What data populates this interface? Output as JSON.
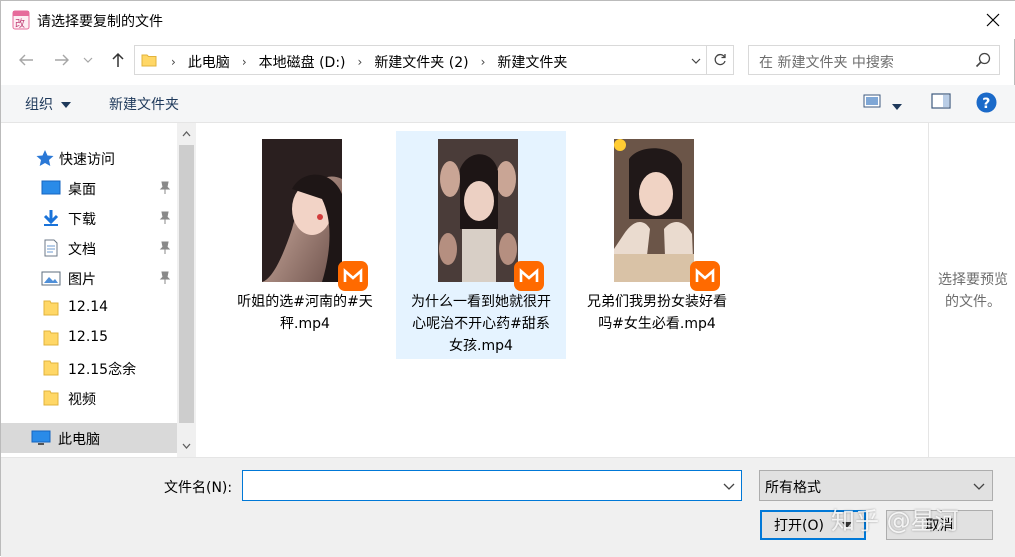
{
  "window": {
    "title": "请选择要复制的文件"
  },
  "address": {
    "crumbs": [
      "此电脑",
      "本地磁盘 (D:)",
      "新建文件夹 (2)",
      "新建文件夹"
    ]
  },
  "search": {
    "placeholder": "在 新建文件夹 中搜索"
  },
  "toolbar": {
    "organize_label": "组织",
    "new_folder_label": "新建文件夹"
  },
  "sidebar": {
    "items": [
      {
        "label": "快速访问",
        "icon": "star-icon"
      },
      {
        "label": "桌面",
        "icon": "desktop-icon",
        "pinned": true
      },
      {
        "label": "下载",
        "icon": "download-icon",
        "pinned": true
      },
      {
        "label": "文档",
        "icon": "document-icon",
        "pinned": true
      },
      {
        "label": "图片",
        "icon": "pictures-icon",
        "pinned": true
      },
      {
        "label": "12.14",
        "icon": "folder-icon"
      },
      {
        "label": "12.15",
        "icon": "folder-icon"
      },
      {
        "label": "12.15念余",
        "icon": "folder-icon"
      },
      {
        "label": "视频",
        "icon": "folder-icon"
      },
      {
        "label": "此电脑",
        "icon": "computer-icon",
        "selected": true
      }
    ]
  },
  "files": [
    {
      "name": "听姐的选#河南的#天秤.mp4",
      "line1": "听姐的选#河南的#天",
      "line2": "秤.mp4",
      "line3": "",
      "selected": false
    },
    {
      "name": "为什么一看到她就很开心呢治不开心药#甜系女孩.mp4",
      "line1": "为什么一看到她就很开",
      "line2": "心呢治不开心药#甜系",
      "line3": "女孩.mp4",
      "selected": true
    },
    {
      "name": "兄弟们我男扮女装好看吗#女生必看.mp4",
      "line1": "兄弟们我男扮女装好看",
      "line2": "吗#女生必看.mp4",
      "line3": "",
      "selected": false
    }
  ],
  "preview": {
    "text_line1": "选择要预览",
    "text_line2": "的文件。"
  },
  "footer": {
    "filename_label": "文件名(N):",
    "filename_value": "",
    "filetype_value": "所有格式",
    "open_label": "打开(O)",
    "cancel_label": "取消"
  },
  "watermark": "知乎 @星河",
  "colors": {
    "accent": "#0078d7",
    "selection": "#e5f3ff",
    "badge": "#ff6a00"
  }
}
